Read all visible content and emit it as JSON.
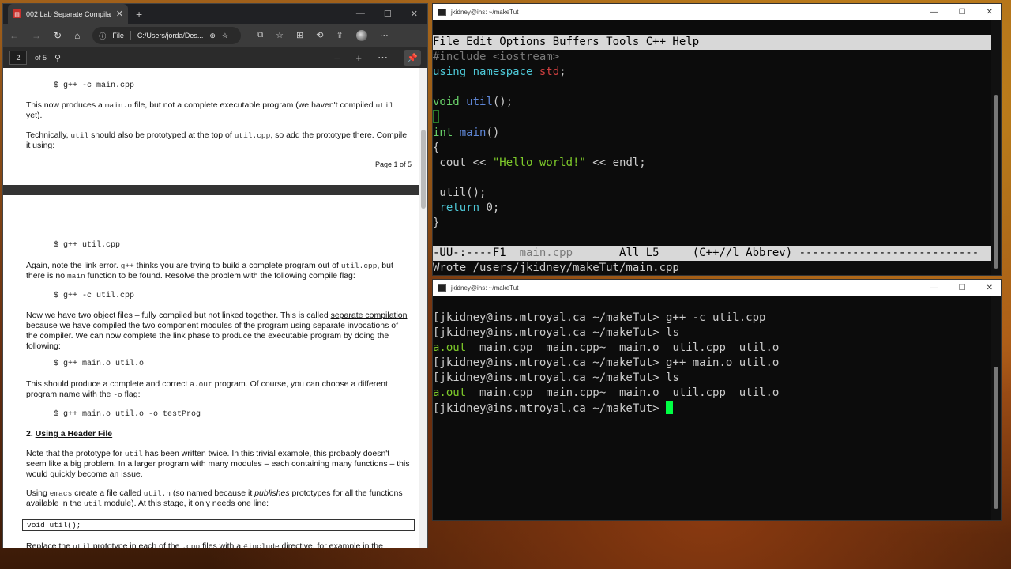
{
  "edge": {
    "tab_title": "002 Lab Separate Compilation.p",
    "new_tab": "+",
    "address_prefix": "File",
    "address": "C:/Users/jorda/Des...",
    "page_current": "2",
    "page_total": "of 5"
  },
  "pdf": {
    "code1": "$ g++ -c main.cpp",
    "p1a": "This now produces a ",
    "p1code": "main.o",
    "p1b": " file, but not a complete executable program (we haven't compiled ",
    "p1code2": "util",
    "p1c": " yet).",
    "p2a": "Technically, ",
    "p2code": "util",
    "p2b": " should also be prototyped at the top of ",
    "p2code2": "util.cpp",
    "p2c": ", so add the prototype there. Compile it using:",
    "page_footer": "Page 1 of 5",
    "code2": "$ g++ util.cpp",
    "p3a": "Again, note the link error. ",
    "p3code": "g++",
    "p3b": " thinks you are trying to build a complete program out of ",
    "p3code2": "util.cpp",
    "p3c": ", but there is no ",
    "p3code3": "main",
    "p3d": " function to be found. Resolve the problem with the following compile flag:",
    "code3": "$ g++ -c util.cpp",
    "p4a": "Now we have two object files – fully compiled but not linked together. This is called ",
    "p4link": "separate compilation",
    "p4b": " because we have compiled the two component modules of the program using separate invocations of the compiler. We can now complete the link phase to produce the executable program by doing the following:",
    "code4": "$ g++ main.o util.o",
    "p5a": "This should produce a complete and correct ",
    "p5code": "a.out",
    "p5b": " program. Of course, you can choose a different program name with the ",
    "p5code2": "-o",
    "p5c": " flag:",
    "code5": "$ g++ main.o util.o -o testProg",
    "h2num": "2. ",
    "h2": "Using a Header File",
    "p6a": "Note that the prototype for ",
    "p6code": "util",
    "p6b": " has been written twice. In this trivial example, this probably doesn't seem like a big problem. In a larger program with many modules – each containing many functions – this would quickly become an issue.",
    "p7a": "Using ",
    "p7code": "emacs",
    "p7b": " create a file called ",
    "p7code2": "util.h",
    "p7c": " (so named because it ",
    "p7em": "publishes",
    "p7d": " prototypes for all the functions available in the ",
    "p7code3": "util",
    "p7e": " module). At this stage, it only needs one line:",
    "codebox": "void util();",
    "p8a": "Replace the ",
    "p8code": "util",
    "p8b": " prototype in each of the ",
    "p8code2": ".cpp",
    "p8c": " files with a ",
    "p8code3": "#include",
    "p8d": " directive, for example in the"
  },
  "emacs": {
    "title": "jkidney@ins: ~/makeTut",
    "menu": "File Edit Options Buffers Tools C++ Help",
    "line1a": "#include ",
    "line1b": "<iostream>",
    "line2a": "using namespace ",
    "line2b": "std",
    "line2c": ";",
    "line4a": "void ",
    "line4b": "util",
    "line4c": "();",
    "line6a": "int ",
    "line6b": "main",
    "line6c": "()",
    "line7": "{",
    "line8a": " cout << ",
    "line8b": "\"Hello world!\"",
    "line8c": " << endl;",
    "line10": " util();",
    "line11a": " ",
    "line11b": "return",
    "line11c": " 0;",
    "line12": "}",
    "modeline_a": "-UU-:----F1  ",
    "modeline_file": "main.cpp",
    "modeline_b": "       All L5     (C++//l Abbrev) ---------------------------",
    "echo": "Wrote /users/jkidney/makeTut/main.cpp"
  },
  "shell": {
    "title": "jkidney@ins: ~/makeTut",
    "prompt": "[jkidney@ins.mtroyal.ca ~/makeTut> ",
    "cmd1": "g++ -c util.cpp",
    "cmd2": "ls",
    "ls1_aout": "a.out",
    "ls1_rest": "  main.cpp  main.cpp~  main.o  util.cpp  util.o",
    "cmd3": "g++ main.o util.o",
    "cmd4": "ls",
    "ls2_aout": "a.out",
    "ls2_rest": "  main.cpp  main.cpp~  main.o  util.cpp  util.o"
  }
}
